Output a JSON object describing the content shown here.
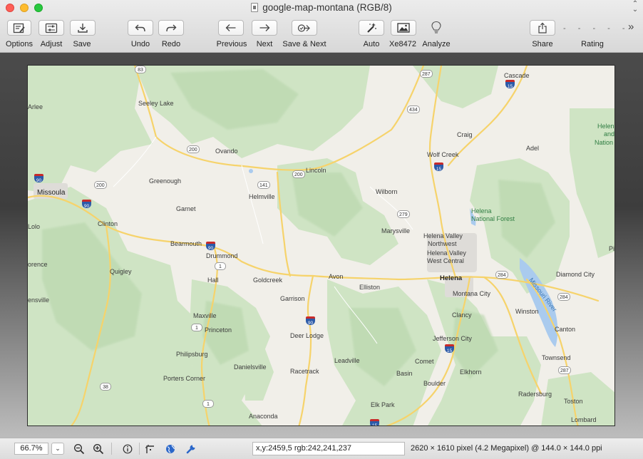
{
  "window": {
    "title": "google-map-montana (RGB/8)"
  },
  "toolbar": {
    "options": "Options",
    "adjust": "Adjust",
    "save": "Save",
    "undo": "Undo",
    "redo": "Redo",
    "previous": "Previous",
    "next": "Next",
    "save_next": "Save & Next",
    "auto": "Auto",
    "xe": "Xe8472",
    "analyze": "Analyze",
    "share": "Share",
    "rating": "Rating",
    "rating_dots": "- - - - -",
    "more": "»"
  },
  "map": {
    "places": {
      "seeley_lake": "Seeley Lake",
      "arlee": "Arlee",
      "missoula": "Missoula",
      "greenough": "Greenough",
      "ovando": "Ovando",
      "lincoln": "Lincoln",
      "helmville": "Helmville",
      "garnet": "Garnet",
      "clinton": "Clinton",
      "bearmouth": "Bearmouth",
      "drummond": "Drummond",
      "lolo": "Lolo",
      "florence": "orence",
      "quigley": "Quigley",
      "hall": "Hall",
      "goldcreek": "Goldcreek",
      "avon": "Avon",
      "elliston": "Elliston",
      "garrison": "Garrison",
      "stevensville": "ensville",
      "maxville": "Maxville",
      "princeton": "Princeton",
      "deer_lodge": "Deer Lodge",
      "philipsburg": "Philipsburg",
      "danielsville": "Danielsville",
      "porters_corner": "Porters Corner",
      "racetrack": "Racetrack",
      "leadville": "Leadville",
      "anaconda": "Anaconda",
      "wilborn": "Wilborn",
      "marysville": "Marysville",
      "craig": "Craig",
      "wolf_creek": "Wolf Creek",
      "cascade": "Cascade",
      "adel": "Adel",
      "helena_valley_nw_1": "Helena Valley",
      "helena_valley_nw_2": "Northwest",
      "helena_valley_wc_1": "Helena Valley",
      "helena_valley_wc_2": "West Central",
      "helena": "Helena",
      "montana_city": "Montana City",
      "clancy": "Clancy",
      "jefferson_city": "Jefferson City",
      "winston": "Winston",
      "diamond_city": "Diamond City",
      "canton": "Canton",
      "townsend": "Townsend",
      "radersburg": "Radersburg",
      "toston": "Toston",
      "lombard": "Lombard",
      "elkhorn": "Elkhorn",
      "boulder": "Boulder",
      "comet": "Comet",
      "basin": "Basin",
      "elk_park": "Elk Park",
      "helena_nf_1": "Helena",
      "helena_nf_2": "National Forest",
      "helena_right_1": "Helen",
      "helena_right_2": "and",
      "helena_right_3": "Nation",
      "pi": "Pi",
      "missouri_river": "Missouri River"
    },
    "routes": {
      "r83": "83",
      "r200a": "200",
      "r200b": "200",
      "r200c": "200",
      "r141": "141",
      "r434": "434",
      "r287a": "287",
      "r287b": "287",
      "r279": "279",
      "r284a": "284",
      "r284b": "284",
      "r1a": "1",
      "r1b": "1",
      "r1c": "1",
      "r38": "38",
      "i90a": "90",
      "i90b": "90",
      "i90c": "90",
      "i90d": "90",
      "i15a": "15",
      "i15b": "15",
      "i15c": "15",
      "i15d": "15"
    }
  },
  "statusbar": {
    "zoom": "66.7%",
    "zoom_dropdown": "⌄",
    "coords": "x,y:2459,5 rgb:242,241,237",
    "image_info": "2620 × 1610 pixel (4.2 Megapixel) @ 144.0 × 144.0 ppi"
  },
  "colors": {
    "forest_green": "#cfe4c4",
    "forest_dark": "#b9d7ad",
    "road_yellow": "#f6d36b",
    "water_blue": "#aacbee",
    "urban_gray": "#dedcd8"
  }
}
